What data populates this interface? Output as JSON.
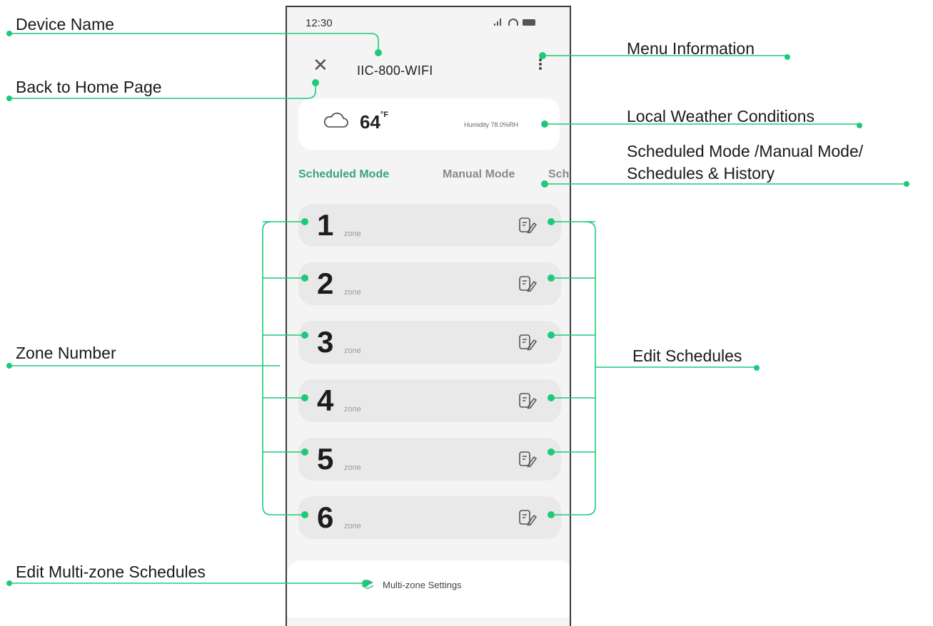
{
  "annotations": {
    "device_name": "Device Name",
    "back_home": "Back to Home Page",
    "menu_info": "Menu Information",
    "weather": "Local Weather Conditions",
    "modes_line1": "Scheduled Mode /Manual Mode/",
    "modes_line2": "Schedules & History",
    "zone_number": "Zone Number",
    "edit_schedules": "Edit Schedules",
    "edit_multi": "Edit Multi-zone Schedules"
  },
  "status_bar": {
    "time": "12:30",
    "icons": [
      "signal-icon",
      "wifi-icon",
      "battery-icon"
    ]
  },
  "header": {
    "close_icon": "close-icon",
    "device_name": "IIC-800-WIFI",
    "menu_icon": "more-vertical-icon"
  },
  "weather": {
    "icon": "cloud-icon",
    "temperature": "64",
    "unit": "°F",
    "humidity": "Humidity  78.0%RH"
  },
  "tabs": [
    {
      "label": "Scheduled Mode",
      "active": true
    },
    {
      "label": "Manual Mode",
      "active": false
    },
    {
      "label": "Sch",
      "active": false
    }
  ],
  "zones": [
    {
      "number": "1",
      "label": "zone"
    },
    {
      "number": "2",
      "label": "zone"
    },
    {
      "number": "3",
      "label": "zone"
    },
    {
      "number": "4",
      "label": "zone"
    },
    {
      "number": "5",
      "label": "zone"
    },
    {
      "number": "6",
      "label": "zone"
    }
  ],
  "bottom": {
    "icon": "layers-icon",
    "label": "Multi-zone Settings"
  },
  "colors": {
    "accent": "#1ec97b",
    "tab_active": "#3aa478",
    "card": "#e9e9e9",
    "background": "#f4f4f4"
  }
}
